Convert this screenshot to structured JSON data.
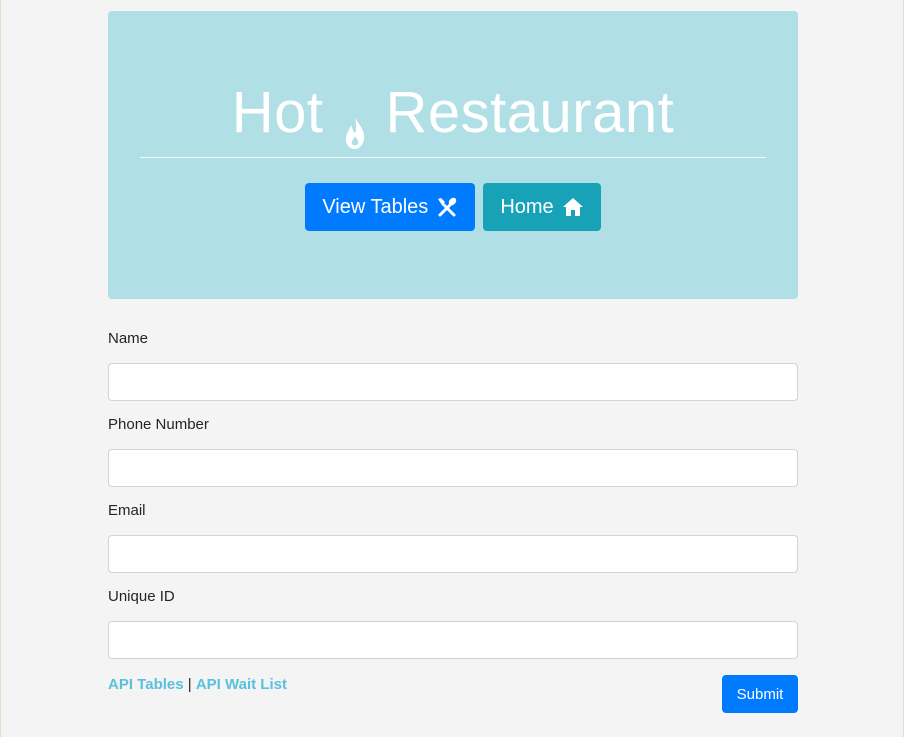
{
  "header": {
    "title_left": "Hot",
    "title_icon": "fire-icon",
    "title_right": "Restaurant",
    "buttons": [
      {
        "label": "View Tables",
        "icon": "utensils-icon",
        "color": "#007bff"
      },
      {
        "label": "Home",
        "icon": "home-icon",
        "color": "#17a2b8"
      }
    ]
  },
  "form": {
    "fields": [
      {
        "label": "Name",
        "value": ""
      },
      {
        "label": "Phone Number",
        "value": ""
      },
      {
        "label": "Email",
        "value": ""
      },
      {
        "label": "Unique ID",
        "value": ""
      }
    ],
    "submit_label": "Submit"
  },
  "links": {
    "api_tables": "API Tables",
    "separator": "|",
    "api_wait_list": "API Wait List"
  },
  "colors": {
    "jumbotron": "#b0dfe5",
    "primary": "#007bff",
    "info": "#17a2b8",
    "link": "#5bc0de",
    "background": "#f4f4f4"
  }
}
